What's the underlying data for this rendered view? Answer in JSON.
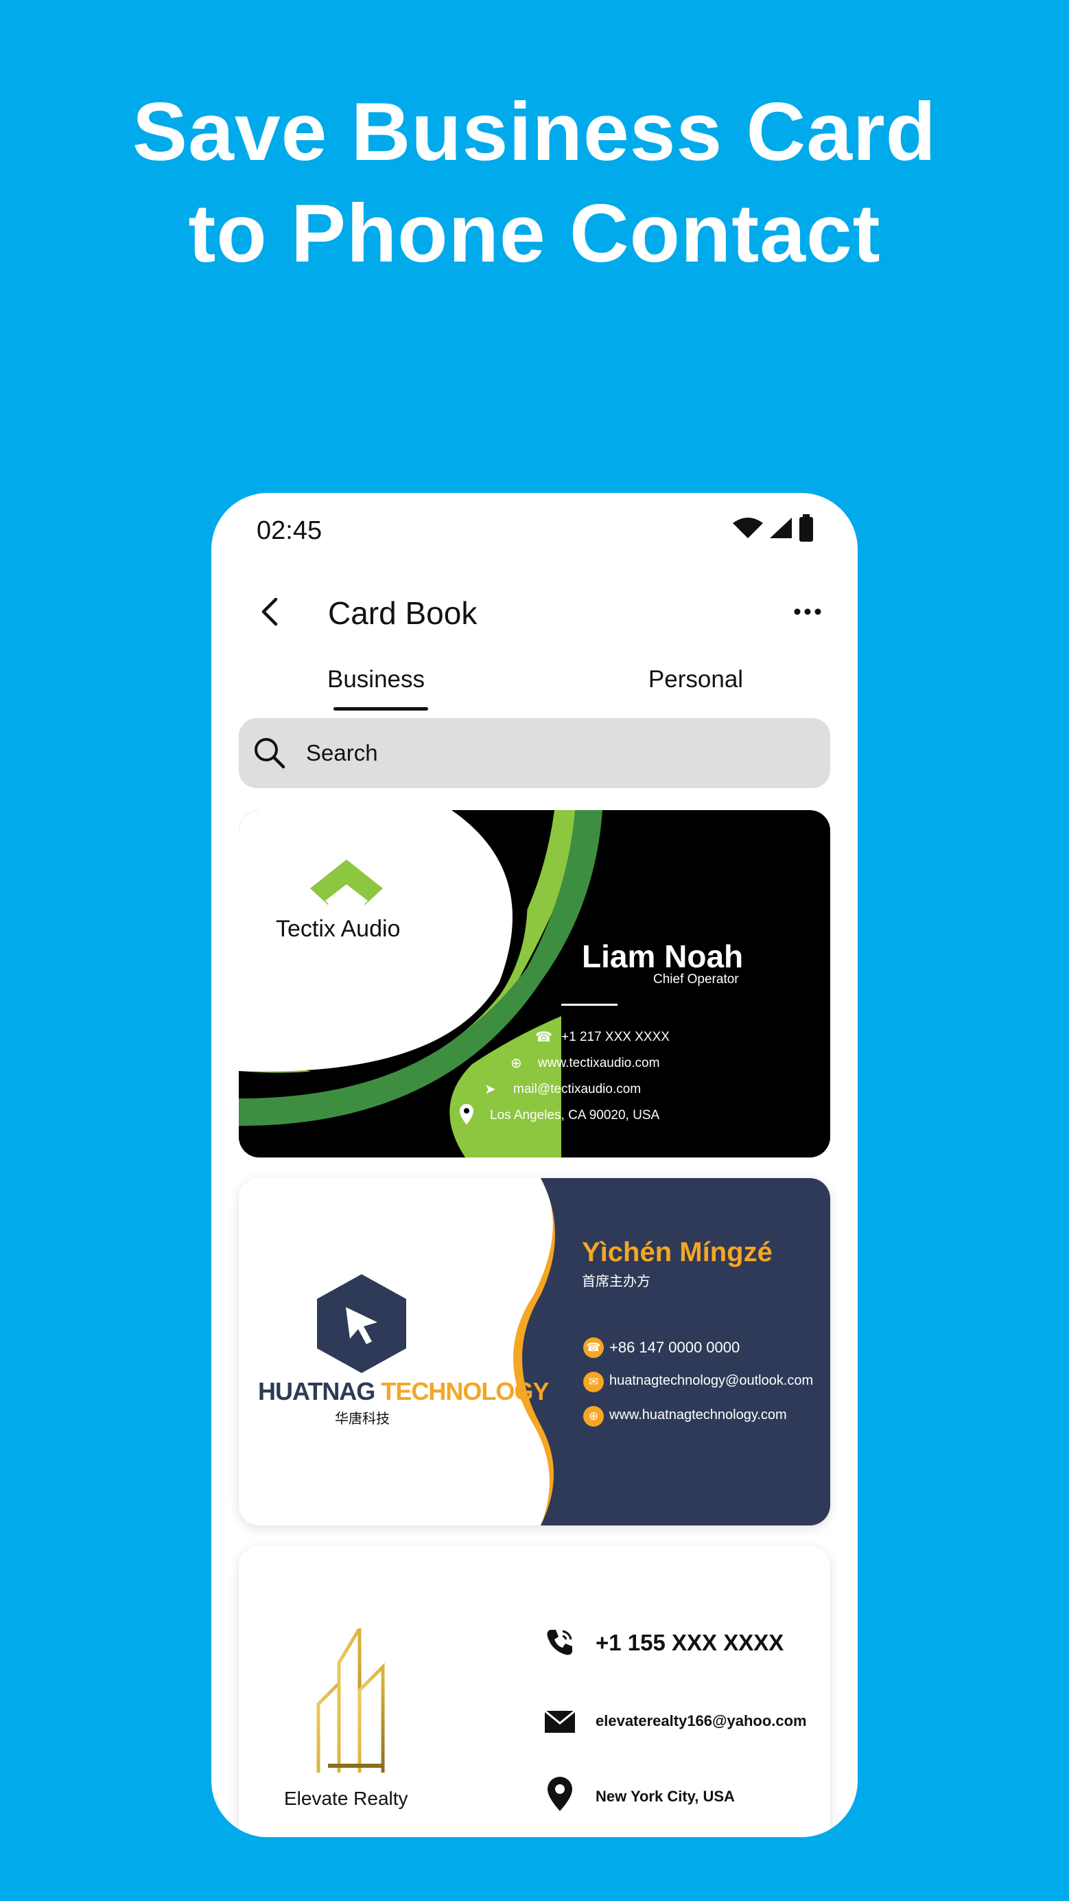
{
  "headline": {
    "line1": "Save Business Card",
    "line2": "to Phone Contact"
  },
  "status_bar": {
    "time": "02:45",
    "icons": [
      "wifi-icon",
      "signal-icon",
      "battery-icon"
    ]
  },
  "app_bar": {
    "title": "Card Book",
    "back_icon": "chevron-left-icon",
    "more_icon": "more-horizontal-icon"
  },
  "tabs": [
    {
      "label": "Business",
      "active": true
    },
    {
      "label": "Personal",
      "active": false
    }
  ],
  "search": {
    "placeholder": "Search"
  },
  "cards": [
    {
      "company": "Tectix Audio",
      "name": "Liam Noah",
      "title": "Chief Operator",
      "phone": "+1 217 XXX XXXX",
      "website": "www.tectixaudio.com",
      "email": "mail@tectixaudio.com",
      "address": "Los Angeles, CA 90020, USA",
      "colors": {
        "background": "#000000",
        "accent": "#8DC63F",
        "accent_dark": "#3E8E41"
      }
    },
    {
      "company_part1": "HUATNAG",
      "company_part2": "TECHNOLOGY",
      "company_cn": "华唐科技",
      "name": "Yìchén Míngzé",
      "title": "首席主办方",
      "phone": "+86 147 0000 0000",
      "email": "huatnagtechnology@outlook.com",
      "website": "www.huatnagtechnology.com",
      "colors": {
        "panel": "#2E3A57",
        "accent": "#F5A623"
      }
    },
    {
      "company": "Elevate Realty",
      "phone": "+1 155 XXX XXXX",
      "email": "elevaterealty166@yahoo.com",
      "address": "New York City, USA",
      "colors": {
        "gold": "#D4AF37",
        "gold_dark": "#8A6D1E"
      }
    }
  ],
  "colors": {
    "page_background": "#00AAEB",
    "phone_background": "#FFFFFF",
    "search_background": "#DEDEDE"
  }
}
